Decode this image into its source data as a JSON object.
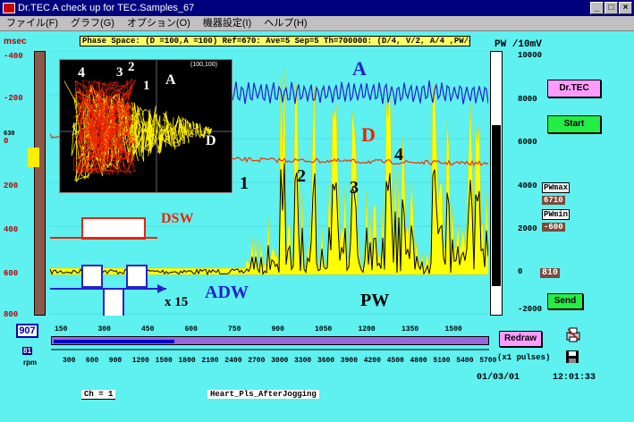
{
  "window": {
    "title": "Dr.TEC     A check up for TEC.Samples_67"
  },
  "menu": [
    "ファイル(F)",
    "グラフ(G)",
    "オプション(O)",
    "機器設定(I)",
    "ヘルプ(H)"
  ],
  "phase_space": "Phase Space: (D =100,A =100) Ref=670: Ave=5 Sep=5 Th=700000: (D/4, V/2, A/4 ,PW/40)",
  "left_axis": {
    "unit": "msec",
    "ticks": [
      "-400",
      "-200",
      "0",
      "200",
      "400",
      "600",
      "800"
    ],
    "marker": "630"
  },
  "right_axis": {
    "unit": "PW /10mV",
    "ticks": [
      "10000",
      "8000",
      "6000",
      "4000",
      "2000",
      "0",
      "-2000"
    ]
  },
  "inset": {
    "coords": "(100,100)",
    "labels": [
      "4",
      "3",
      "2",
      "1",
      "A",
      "D"
    ]
  },
  "labels": {
    "A": "A",
    "D": "D",
    "DSW": "DSW",
    "ADW": "ADW",
    "PW": "PW",
    "x15": "x 15",
    "n1": "1",
    "n2": "2",
    "n3": "3",
    "n4": "4"
  },
  "buttons": {
    "drtec": "Dr.TEC",
    "start": "Start",
    "send": "Send",
    "redraw": "Redraw"
  },
  "pw": {
    "max_label": "PWmax",
    "max_value": "6710",
    "min_label": "PWmin",
    "min_value": "-600",
    "current": "810"
  },
  "counter": "907",
  "rpm_value": "81",
  "rpm_label": "rpm",
  "x_axis_top": [
    "150",
    "300",
    "450",
    "600",
    "750",
    "900",
    "1050",
    "1200",
    "1350",
    "1500"
  ],
  "x_axis_bottom": [
    "300",
    "600",
    "900",
    "1200",
    "1500",
    "1800",
    "2100",
    "2400",
    "2700",
    "3000",
    "3300",
    "3600",
    "3900",
    "4200",
    "4500",
    "4800",
    "5100",
    "5400",
    "5700"
  ],
  "pulses": "(x1 pulses)",
  "channel": "Ch  =  1",
  "filename": "Heart_Pls_AfterJogging",
  "date": "01/03/01",
  "time": "12:01:33",
  "colors": {
    "bg": "#5ff0f0",
    "A": "#2222cc",
    "D": "#ee2200",
    "PW": "#000000",
    "PWfill": "#ffff00"
  },
  "icons": {
    "print": "print-icon",
    "save": "save-disk-icon"
  }
}
